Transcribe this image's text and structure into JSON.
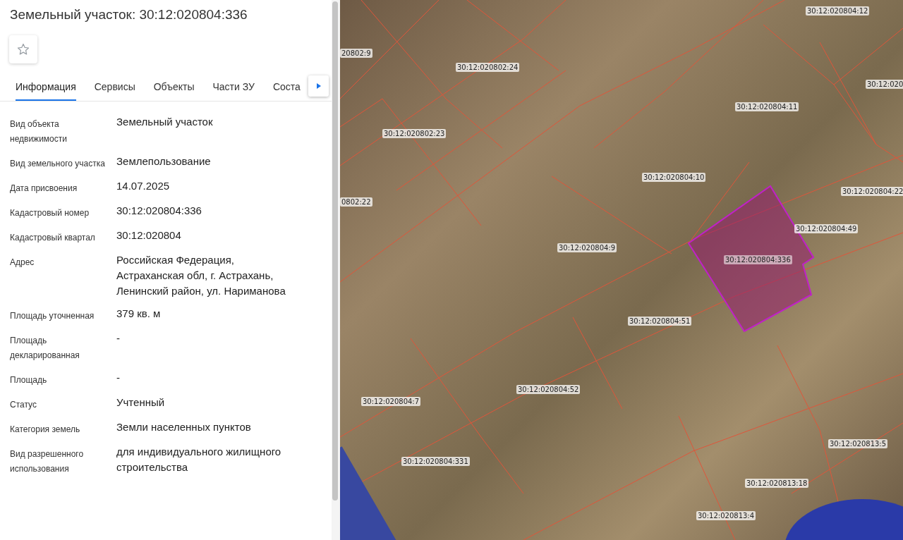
{
  "title": "Земельный участок: 30:12:020804:336",
  "favorite": {
    "on": false
  },
  "tabs": [
    {
      "label": "Информация",
      "selected": true
    },
    {
      "label": "Сервисы",
      "selected": false
    },
    {
      "label": "Объекты",
      "selected": false
    },
    {
      "label": "Части ЗУ",
      "selected": false
    },
    {
      "label": "Соста",
      "selected": false
    }
  ],
  "properties": [
    {
      "label": "Вид объекта недвижимости",
      "value": "Земельный участок"
    },
    {
      "label": "Вид земельного участка",
      "value": "Землепользование"
    },
    {
      "label": "Дата присвоения",
      "value": "14.07.2025"
    },
    {
      "label": "Кадастровый номер",
      "value": "30:12:020804:336"
    },
    {
      "label": "Кадастровый квартал",
      "value": "30:12:020804"
    },
    {
      "label": "Адрес",
      "value": "Российская Федерация,\nАстраханская обл, г. Астрахань,\nЛенинский район, ул. Нариманова"
    },
    {
      "label": "Площадь уточненная",
      "value": "379 кв. м"
    },
    {
      "label": "Площадь декларированная",
      "value": "-"
    },
    {
      "label": "Площадь",
      "value": "-"
    },
    {
      "label": "Статус",
      "value": "Учтенный"
    },
    {
      "label": "Категория земель",
      "value": "Земли населенных пунктов"
    },
    {
      "label": "Вид разрешенного использования",
      "value": "для индивидуального жилищного строительства"
    }
  ],
  "map": {
    "parcels": [
      {
        "label": "20802:9",
        "selected": false
      },
      {
        "label": "30:12:020802:24",
        "selected": false
      },
      {
        "label": "30:12:020802:23",
        "selected": false
      },
      {
        "label": "30:12:020804:12",
        "selected": false
      },
      {
        "label": "30:12:020804:11",
        "selected": false
      },
      {
        "label": "30:12:020",
        "selected": false
      },
      {
        "label": "30:12:020804:10",
        "selected": false
      },
      {
        "label": "0802:22",
        "selected": false
      },
      {
        "label": "30:12:020804:9",
        "selected": false
      },
      {
        "label": "30:12:020804:22",
        "selected": false
      },
      {
        "label": "30:12:020804:49",
        "selected": false
      },
      {
        "label": "30:12:020804:336",
        "selected": true
      },
      {
        "label": "30:12:020804:51",
        "selected": false
      },
      {
        "label": "30:12:020804:52",
        "selected": false
      },
      {
        "label": "30:12:020804:7",
        "selected": false
      },
      {
        "label": "30:12:020804:331",
        "selected": false
      },
      {
        "label": "30:12:020813:5",
        "selected": false
      },
      {
        "label": "30:12:020813:18",
        "selected": false
      },
      {
        "label": "30:12:020813:4",
        "selected": false
      }
    ]
  }
}
